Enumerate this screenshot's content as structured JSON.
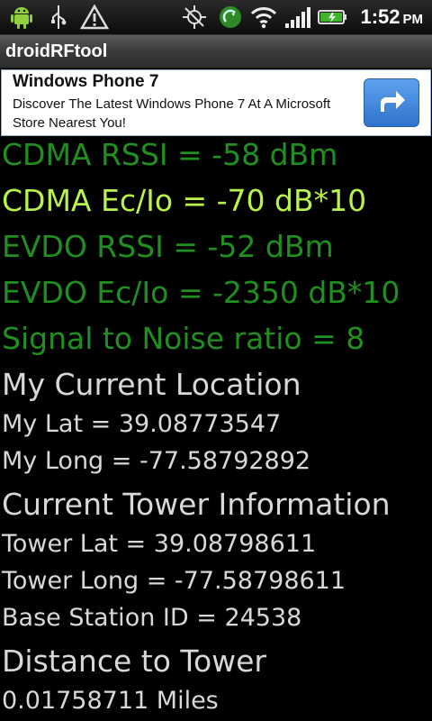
{
  "status_bar": {
    "time": "1:52",
    "ampm": "PM",
    "icons": [
      "android-icon",
      "usb-icon",
      "warning-icon",
      "gps-icon",
      "sync-icon",
      "wifi-icon",
      "signal-icon",
      "battery-icon"
    ]
  },
  "app": {
    "title": "droidRFtool"
  },
  "ad": {
    "title": "Windows Phone 7",
    "body": "Discover The Latest Windows Phone 7 At A Microsoft Store Nearest You!",
    "button_icon": "share-arrow-icon"
  },
  "readings": {
    "cdma_rssi": "CDMA RSSI = -58 dBm",
    "cdma_ecio": "CDMA Ec/Io = -70 dB*10",
    "evdo_rssi": "EVDO RSSI = -52 dBm",
    "evdo_ecio": "EVDO Ec/Io = -2350 dB*10",
    "snr": "Signal to Noise ratio = 8"
  },
  "location": {
    "heading": "My Current Location",
    "lat": "My Lat = 39.08773547",
    "long": "My Long = -77.58792892"
  },
  "tower": {
    "heading": "Current Tower Information",
    "lat": "Tower Lat = 39.08798611",
    "long": "Tower Long = -77.58798611",
    "base_station": "Base Station ID = 24538"
  },
  "distance": {
    "heading": "Distance to Tower",
    "value": "0.01758711 Miles"
  },
  "colors": {
    "reading_green": "#1f8f1f",
    "highlight_green": "#b8f24a",
    "text_gray": "#d8d8d8"
  }
}
